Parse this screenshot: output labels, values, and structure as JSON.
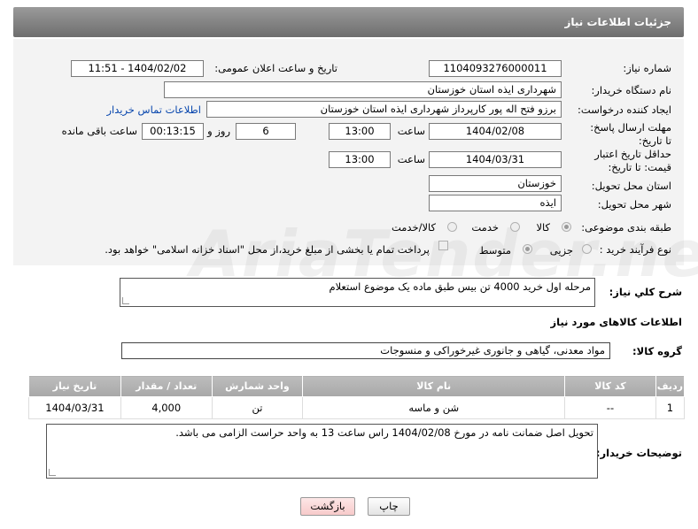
{
  "header": {
    "title": "جزئیات اطلاعات نیاز"
  },
  "form": {
    "need_number_label": "شماره نیاز:",
    "need_number": "1104093276000011",
    "announce_label": "تاریخ و ساعت اعلان عمومی:",
    "announce_value": "1404/02/02 - 11:51",
    "buyer_org_label": "نام دستگاه خریدار:",
    "buyer_org": "شهرداری ایذه استان خوزستان",
    "creator_label": "ایجاد کننده درخواست:",
    "creator": "برزو فتح اله پور کارپرداز شهرداری ایذه استان خوزستان",
    "contact_link": "اطلاعات تماس خریدار",
    "reply_deadline_label": "مهلت ارسال پاسخ: تا تاریخ:",
    "reply_date": "1404/02/08",
    "time_label": "ساعت",
    "reply_time": "13:00",
    "days_value": "6",
    "days_label": "روز و",
    "remaining_time": "00:13:15",
    "remaining_label": "ساعت باقی مانده",
    "price_validity_label": "حداقل تاریخ اعتبار قیمت: تا تاریخ:",
    "validity_date": "1404/03/31",
    "validity_time_label": "ساعت",
    "validity_time": "13:00",
    "province_label": "استان محل تحویل:",
    "province": "خوزستان",
    "city_label": "شهر محل تحویل:",
    "city": "ایذه",
    "category_label": "طبقه بندی موضوعی:",
    "category_options": [
      "کالا",
      "خدمت",
      "کالا/خدمت"
    ],
    "process_label": "نوع فرآیند خرید :",
    "process_options": [
      "جزیی",
      "متوسط"
    ],
    "payment_note": "پرداخت تمام یا بخشی از مبلغ خرید،از محل \"اسناد خزانه اسلامی\" خواهد بود."
  },
  "summary": {
    "label": "شرح کلي نياز:",
    "text": "مرحله اول خرید 4000 تن بیس طبق ماده یک موضوع استعلام"
  },
  "goods_info_title": "اطلاعات کالاهای مورد نیاز",
  "goods_group": {
    "label": "گروه کالا:",
    "value": "مواد معدنی، گیاهی و جانوری غیرخوراکی و منسوجات"
  },
  "table": {
    "headers": [
      "ردیف",
      "کد کالا",
      "نام کالا",
      "واحد شمارش",
      "تعداد / مقدار",
      "تاریخ نیاز"
    ],
    "rows": [
      [
        "1",
        "--",
        "شن و ماسه",
        "تن",
        "4,000",
        "1404/03/31"
      ]
    ]
  },
  "buyer_notes": {
    "label": "توضیحات خریدار:",
    "text": "تحویل اصل ضمانت نامه در مورخ 1404/02/08 راس ساعت 13 به واحد حراست الزامی می باشد."
  },
  "buttons": {
    "print": "چاپ",
    "back": "بازگشت"
  },
  "watermark": "AriaTender.neT"
}
